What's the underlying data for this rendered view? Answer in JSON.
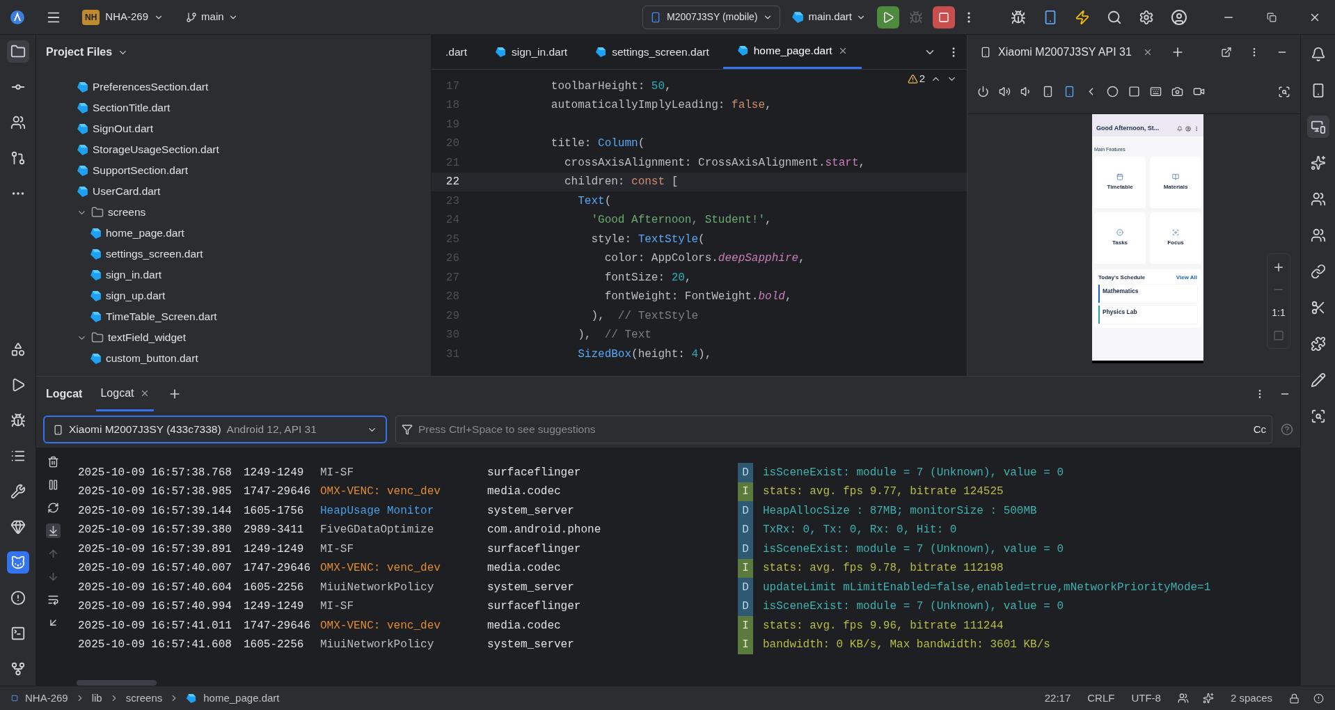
{
  "top_bar": {
    "project_badge": "NH",
    "project": "NHA-269",
    "branch": "main",
    "device": "M2007J3SY (mobile)",
    "run_config": "main.dart"
  },
  "project_panel": {
    "title": "Project Files",
    "tree": [
      {
        "children": [
          {
            "children": [
              {
                "label": "PreferencesSection.dart",
                "kind": "file"
              },
              {
                "label": "SectionTitle.dart",
                "kind": "file"
              },
              {
                "label": "SignOut.dart",
                "kind": "file"
              },
              {
                "label": "StorageUsageSection.dart",
                "kind": "file"
              },
              {
                "label": "SupportSection.dart",
                "kind": "file"
              },
              {
                "label": "UserCard.dart",
                "kind": "file"
              }
            ]
          }
        ]
      },
      {
        "label": "screens",
        "kind": "folder",
        "expanded": true,
        "children": [
          {
            "label": "home_page.dart",
            "kind": "file"
          },
          {
            "label": "settings_screen.dart",
            "kind": "file"
          },
          {
            "label": "sign_in.dart",
            "kind": "file"
          },
          {
            "label": "sign_up.dart",
            "kind": "file"
          },
          {
            "label": "TimeTable_Screen.dart",
            "kind": "file"
          }
        ]
      },
      {
        "label": "textField_widget",
        "kind": "folder",
        "expanded": true,
        "children": [
          {
            "label": "custom_button.dart",
            "kind": "file"
          }
        ]
      }
    ]
  },
  "editor": {
    "tabs": [
      {
        "label": ".dart",
        "selected": false,
        "closable": false
      },
      {
        "label": "sign_in.dart",
        "selected": false,
        "closable": false
      },
      {
        "label": "settings_screen.dart",
        "selected": false,
        "closable": false
      },
      {
        "label": "home_page.dart",
        "selected": true,
        "closable": true
      }
    ],
    "warnings": "2",
    "lines": [
      {
        "number": "17",
        "current": false,
        "tokens": [
          {
            "text": "        toolbarHeight: ",
            "kind": "plain"
          },
          {
            "text": "50",
            "kind": "number"
          },
          {
            "text": ",",
            "kind": "plain"
          }
        ]
      },
      {
        "number": "18",
        "current": false,
        "tokens": [
          {
            "text": "        automaticallyImplyLeading: ",
            "kind": "plain"
          },
          {
            "text": "false",
            "kind": "keyword"
          },
          {
            "text": ",",
            "kind": "plain"
          }
        ]
      },
      {
        "number": "19",
        "current": false
      },
      {
        "number": "20",
        "current": false,
        "tokens": [
          {
            "text": "        title: ",
            "kind": "plain"
          },
          {
            "text": "Column",
            "kind": "class"
          },
          {
            "text": "(",
            "kind": "plain"
          }
        ]
      },
      {
        "number": "21",
        "current": false,
        "tokens": [
          {
            "text": "          crossAxisAlignment: CrossAxisAlignment.",
            "kind": "plain"
          },
          {
            "text": "start",
            "kind": "field"
          },
          {
            "text": ",",
            "kind": "plain"
          }
        ]
      },
      {
        "number": "22",
        "current": true,
        "tokens": [
          {
            "text": "          children: ",
            "kind": "plain"
          },
          {
            "text": "const",
            "kind": "keyword"
          },
          {
            "text": " [",
            "kind": "plain"
          }
        ]
      },
      {
        "number": "23",
        "current": false,
        "tokens": [
          {
            "text": "            Text",
            "kind": "class"
          },
          {
            "text": "(",
            "kind": "plain"
          }
        ]
      },
      {
        "number": "24",
        "current": false,
        "tokens": [
          {
            "text": "              'Good Afternoon, Student!'",
            "kind": "string"
          },
          {
            "text": ",",
            "kind": "plain"
          }
        ]
      },
      {
        "number": "25",
        "current": false,
        "tokens": [
          {
            "text": "              style: ",
            "kind": "plain"
          },
          {
            "text": "TextStyle",
            "kind": "class"
          },
          {
            "text": "(",
            "kind": "plain"
          }
        ]
      },
      {
        "number": "26",
        "current": false,
        "tokens": [
          {
            "text": "                color: AppColors.",
            "kind": "plain"
          },
          {
            "text": "deepSapphire",
            "kind": "static"
          },
          {
            "text": ",",
            "kind": "plain"
          }
        ]
      },
      {
        "number": "27",
        "current": false,
        "tokens": [
          {
            "text": "                fontSize: ",
            "kind": "plain"
          },
          {
            "text": "20",
            "kind": "number"
          },
          {
            "text": ",",
            "kind": "plain"
          }
        ]
      },
      {
        "number": "28",
        "current": false,
        "tokens": [
          {
            "text": "                fontWeight: FontWeight.",
            "kind": "plain"
          },
          {
            "text": "bold",
            "kind": "static"
          },
          {
            "text": ",",
            "kind": "plain"
          }
        ]
      },
      {
        "number": "29",
        "current": false,
        "tokens": [
          {
            "text": "              ),  ",
            "kind": "plain"
          },
          {
            "text": "// TextStyle",
            "kind": "comment"
          }
        ]
      },
      {
        "number": "30",
        "current": false,
        "tokens": [
          {
            "text": "            ),  ",
            "kind": "plain"
          },
          {
            "text": "// Text",
            "kind": "comment"
          }
        ]
      },
      {
        "number": "31",
        "current": false,
        "tokens": [
          {
            "text": "            SizedBox",
            "kind": "class"
          },
          {
            "text": "(height: ",
            "kind": "plain"
          },
          {
            "text": "4",
            "kind": "number"
          },
          {
            "text": "),",
            "kind": "plain"
          }
        ]
      }
    ]
  },
  "emulator": {
    "tab": "Xiaomi M2007J3SY API 31",
    "zoom_label": "1:1",
    "phone": {
      "title": "Good Afternoon, St...",
      "section": "Main Features",
      "features": [
        {
          "label": "Timetable"
        },
        {
          "label": "Materials"
        },
        {
          "label": "Tasks"
        },
        {
          "label": "Focus"
        }
      ],
      "schedule_title": "Today's Schedule",
      "view_all": "View All",
      "classes": [
        {
          "name": "Mathematics",
          "color": "#1565c0"
        },
        {
          "name": "Physics Lab",
          "color": "#26a69a"
        }
      ]
    }
  },
  "logcat": {
    "title": "Logcat",
    "tabs": [
      {
        "label": "Logcat",
        "selected": true
      }
    ],
    "device": "Xiaomi M2007J3SY (433c7338)",
    "device_info": "Android 12, API 31",
    "filter_placeholder": "Press Ctrl+Space to see suggestions",
    "case_toggle": "Cc",
    "rows": [
      {
        "time": "2025-10-09 16:57:38.768",
        "pid": "1249-1249",
        "tag": {
          "text": "MI-SF",
          "color": "#bcbec4"
        },
        "package": "surfaceflinger",
        "level": "D",
        "kind": "debug",
        "message": "isSceneExist: module = 7 (Unknown), value = 0"
      },
      {
        "time": "2025-10-09 16:57:38.985",
        "pid": "1747-29646",
        "tag": {
          "text": "OMX-VENC: venc_dev",
          "color": "#e08c36"
        },
        "package": "media.codec",
        "level": "I",
        "kind": "info",
        "message": "stats: avg. fps 9.77, bitrate 124525"
      },
      {
        "time": "2025-10-09 16:57:39.144",
        "pid": "1605-1756",
        "tag": {
          "text": "HeapUsage Monitor",
          "color": "#4a9ee8"
        },
        "package": "system_server",
        "level": "D",
        "kind": "debug",
        "message": "HeapAllocSize : 87MB; monitorSize : 500MB"
      },
      {
        "time": "2025-10-09 16:57:39.380",
        "pid": "2989-3411",
        "tag": {
          "text": "FiveGDataOptimize",
          "color": "#bcbec4"
        },
        "package": "com.android.phone",
        "level": "D",
        "kind": "debug",
        "message": "TxRx: 0, Tx: 0, Rx: 0, Hit: 0"
      },
      {
        "time": "2025-10-09 16:57:39.891",
        "pid": "1249-1249",
        "tag": {
          "text": "MI-SF",
          "color": "#bcbec4"
        },
        "package": "surfaceflinger",
        "level": "D",
        "kind": "debug",
        "message": "isSceneExist: module = 7 (Unknown), value = 0"
      },
      {
        "time": "2025-10-09 16:57:40.007",
        "pid": "1747-29646",
        "tag": {
          "text": "OMX-VENC: venc_dev",
          "color": "#e08c36"
        },
        "package": "media.codec",
        "level": "I",
        "kind": "info",
        "message": "stats: avg. fps 9.78, bitrate 112198"
      },
      {
        "time": "2025-10-09 16:57:40.604",
        "pid": "1605-2256",
        "tag": {
          "text": "MiuiNetworkPolicy",
          "color": "#bcbec4"
        },
        "package": "system_server",
        "level": "D",
        "kind": "debug",
        "message": "updateLimit mLimitEnabled=false,enabled=true,mNetworkPriorityMode=1"
      },
      {
        "time": "2025-10-09 16:57:40.994",
        "pid": "1249-1249",
        "tag": {
          "text": "MI-SF",
          "color": "#bcbec4"
        },
        "package": "surfaceflinger",
        "level": "D",
        "kind": "debug",
        "message": "isSceneExist: module = 7 (Unknown), value = 0"
      },
      {
        "time": "2025-10-09 16:57:41.011",
        "pid": "1747-29646",
        "tag": {
          "text": "OMX-VENC: venc_dev",
          "color": "#e08c36"
        },
        "package": "media.codec",
        "level": "I",
        "kind": "info",
        "message": "stats: avg. fps 9.96, bitrate 111244"
      },
      {
        "time": "2025-10-09 16:57:41.608",
        "pid": "1605-2256",
        "tag": {
          "text": "MiuiNetworkPolicy",
          "color": "#bcbec4"
        },
        "package": "system_server",
        "level": "I",
        "kind": "info",
        "message": "bandwidth: 0 KB/s, Max bandwidth: 3601 KB/s"
      }
    ]
  },
  "status_bar": {
    "breadcrumbs": [
      "NHA-269",
      "lib",
      "screens",
      "home_page.dart"
    ],
    "position": "22:17",
    "line_ending": "CRLF",
    "encoding": "UTF-8",
    "indent": "2 spaces"
  }
}
